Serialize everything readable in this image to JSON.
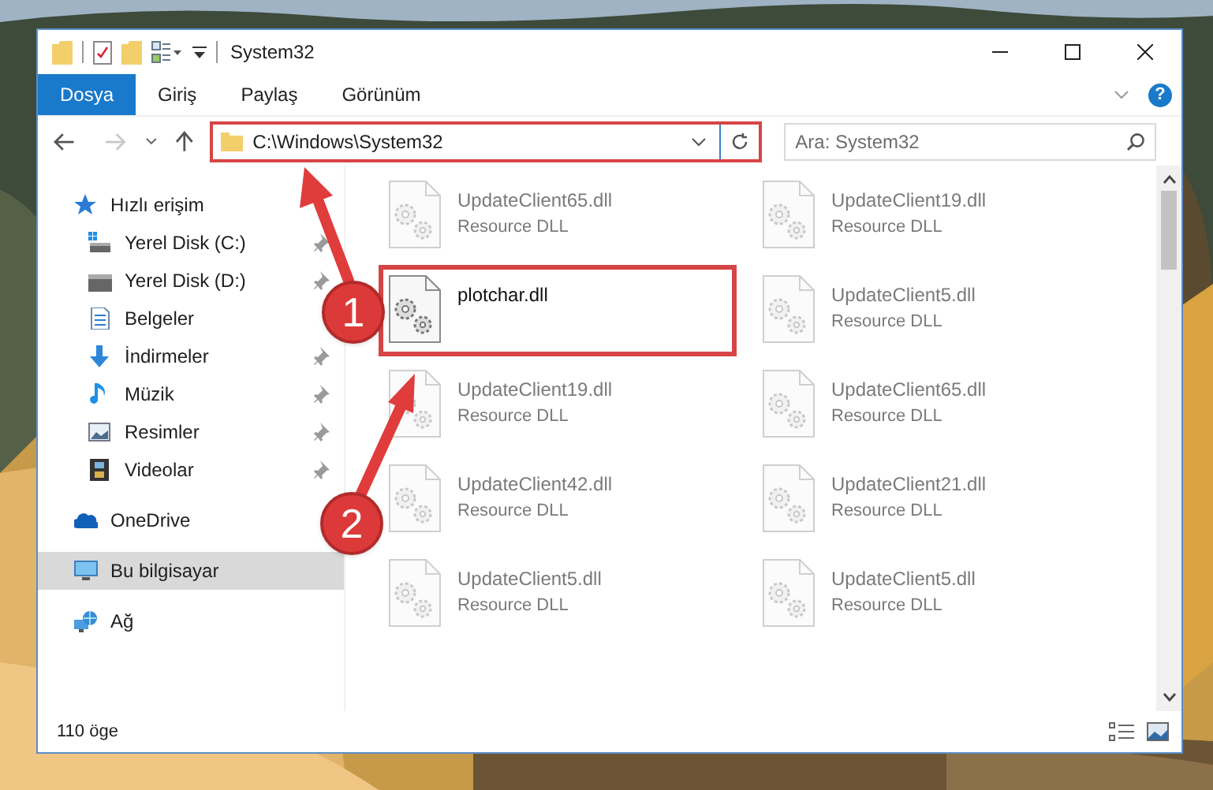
{
  "window": {
    "title": "System32"
  },
  "ribbon": {
    "tabs": [
      {
        "label": "Dosya",
        "selected": true
      },
      {
        "label": "Giriş",
        "selected": false
      },
      {
        "label": "Paylaş",
        "selected": false
      },
      {
        "label": "Görünüm",
        "selected": false
      }
    ],
    "help_button": "?"
  },
  "address_bar": {
    "path": "C:\\Windows\\System32",
    "highlighted": true
  },
  "search": {
    "placeholder": "Ara: System32"
  },
  "sidebar": {
    "items": [
      {
        "label": "Hızlı erişim",
        "kind": "star",
        "pinned": false,
        "selected": false,
        "children": [
          {
            "label": "Yerel Disk (C:)",
            "kind": "windisk",
            "pinned": true,
            "selected": false
          },
          {
            "label": "Yerel Disk (D:)",
            "kind": "disk",
            "pinned": true,
            "selected": false
          },
          {
            "label": "Belgeler",
            "kind": "document",
            "pinned": false,
            "selected": false
          },
          {
            "label": "İndirmeler",
            "kind": "download",
            "pinned": true,
            "selected": false
          },
          {
            "label": "Müzik",
            "kind": "music",
            "pinned": true,
            "selected": false
          },
          {
            "label": "Resimler",
            "kind": "pictures",
            "pinned": true,
            "selected": false
          },
          {
            "label": "Videolar",
            "kind": "video",
            "pinned": true,
            "selected": false
          }
        ]
      },
      {
        "label": "OneDrive",
        "kind": "cloud",
        "pinned": false,
        "selected": false
      },
      {
        "label": "Bu bilgisayar",
        "kind": "computer",
        "pinned": false,
        "selected": true
      },
      {
        "label": "Ağ",
        "kind": "network",
        "pinned": false,
        "selected": false
      }
    ]
  },
  "files": [
    {
      "name": "UpdateClient65.dll",
      "type": "Resource DLL",
      "faded": true,
      "highlighted": false
    },
    {
      "name": "UpdateClient19.dll",
      "type": "Resource DLL",
      "faded": true,
      "highlighted": false
    },
    {
      "name": "plotchar.dll",
      "faded": false,
      "highlighted": true
    },
    {
      "name": "UpdateClient5.dll",
      "type": "Resource DLL",
      "faded": true,
      "highlighted": false
    },
    {
      "name": "UpdateClient19.dll",
      "type": "Resource DLL",
      "faded": true,
      "highlighted": false
    },
    {
      "name": "UpdateClient65.dll",
      "type": "Resource DLL",
      "faded": true,
      "highlighted": false
    },
    {
      "name": "UpdateClient42.dll",
      "type": "Resource DLL",
      "faded": true,
      "highlighted": false
    },
    {
      "name": "UpdateClient21.dll",
      "type": "Resource DLL",
      "faded": true,
      "highlighted": false
    },
    {
      "name": "UpdateClient5.dll",
      "type": "Resource DLL",
      "faded": true,
      "highlighted": false
    },
    {
      "name": "UpdateClient5.dll",
      "type": "Resource DLL",
      "faded": true,
      "highlighted": false
    }
  ],
  "status_bar": {
    "item_count": "110 öge"
  },
  "annotations": [
    {
      "number": "1"
    },
    {
      "number": "2"
    }
  ]
}
